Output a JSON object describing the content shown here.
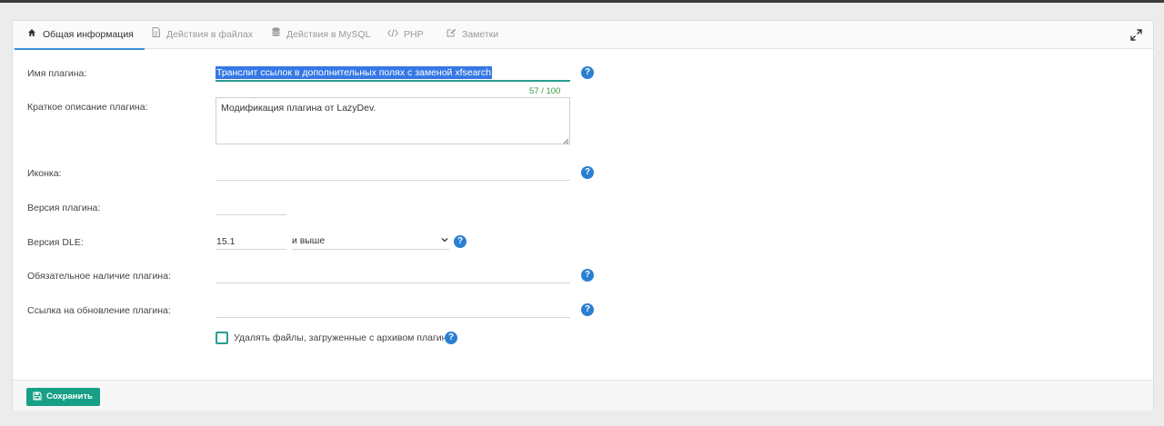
{
  "tabs": [
    {
      "label": "Общая информация",
      "icon": "home-icon",
      "active": true
    },
    {
      "label": "Действия в файлах",
      "icon": "file-icon",
      "active": false
    },
    {
      "label": "Действия в MySQL",
      "icon": "database-icon",
      "active": false
    },
    {
      "label": "PHP",
      "icon": "code-icon",
      "active": false
    },
    {
      "label": "Заметки",
      "icon": "edit-icon",
      "active": false
    }
  ],
  "form": {
    "name_label": "Имя плагина:",
    "name_value": "Транслит ссылок в дополнительных полях с заменой xfsearch",
    "name_counter": "57 / 100",
    "description_label": "Краткое описание плагина:",
    "description_value": "Модификация плагина от LazyDev.",
    "icon_label": "Иконка:",
    "icon_value": "",
    "version_label": "Версия плагина:",
    "version_value": "",
    "dle_version_label": "Версия DLE:",
    "dle_version_value": "15.1",
    "dle_version_mode": "и выше",
    "required_label": "Обязательное наличие плагина:",
    "required_value": "",
    "update_link_label": "Ссылка на обновление плагина:",
    "update_link_value": "",
    "delete_files_label": "Удалять файлы, загруженные с архивом плагина",
    "delete_files_checked": false,
    "help_symbol": "?"
  },
  "footer": {
    "save_label": "Сохранить"
  },
  "colors": {
    "accent": "#2a9d8f",
    "save_button": "#17a086",
    "help": "#2a7fd4",
    "tab_underline": "#3b8ed8",
    "counter": "#3a9c3a"
  }
}
